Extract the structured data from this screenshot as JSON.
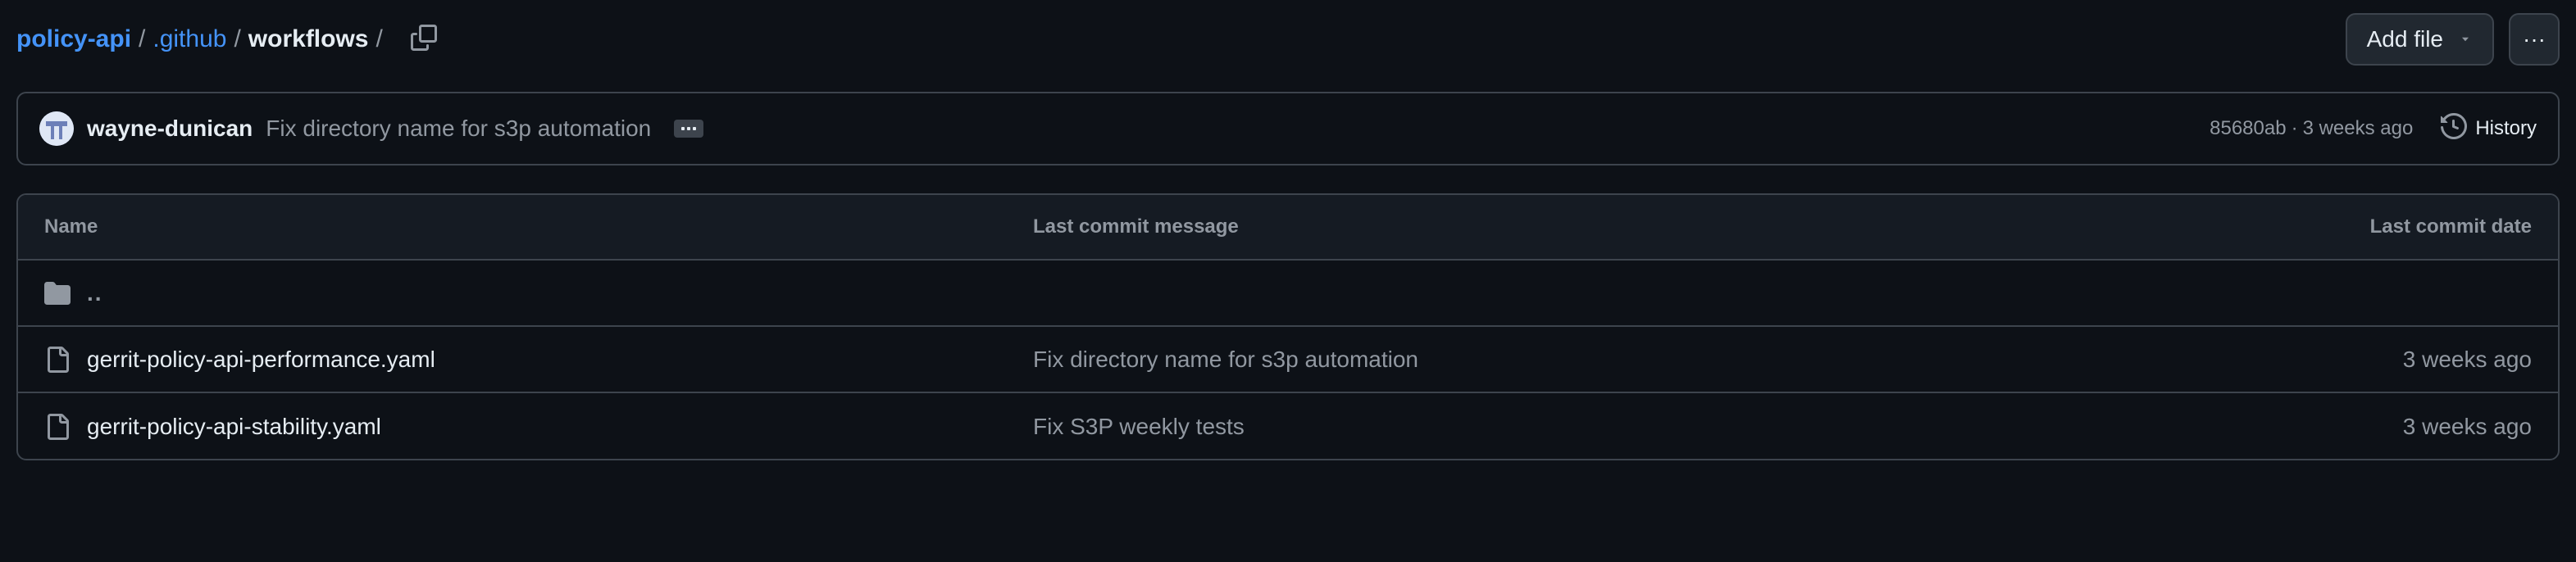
{
  "breadcrumb": {
    "repo": "policy-api",
    "folder": ".github",
    "current": "workflows",
    "separator": "/"
  },
  "actions": {
    "add_file_label": "Add file",
    "more_label": "···"
  },
  "commit": {
    "author": "wayne-dunican",
    "message": "Fix directory name for s3p automation",
    "sha": "85680ab",
    "age": "3 weeks ago",
    "meta_sep": "·",
    "history_label": "History"
  },
  "table": {
    "headers": {
      "name": "Name",
      "message": "Last commit message",
      "date": "Last commit date"
    },
    "parent": "..",
    "rows": [
      {
        "name": "gerrit-policy-api-performance.yaml",
        "message": "Fix directory name for s3p automation",
        "date": "3 weeks ago"
      },
      {
        "name": "gerrit-policy-api-stability.yaml",
        "message": "Fix S3P weekly tests",
        "date": "3 weeks ago"
      }
    ]
  },
  "colors": {
    "background": "#0d1117",
    "link": "#4493f8",
    "border": "#3d444d",
    "muted": "#9198a1",
    "text": "#e6edf3"
  }
}
